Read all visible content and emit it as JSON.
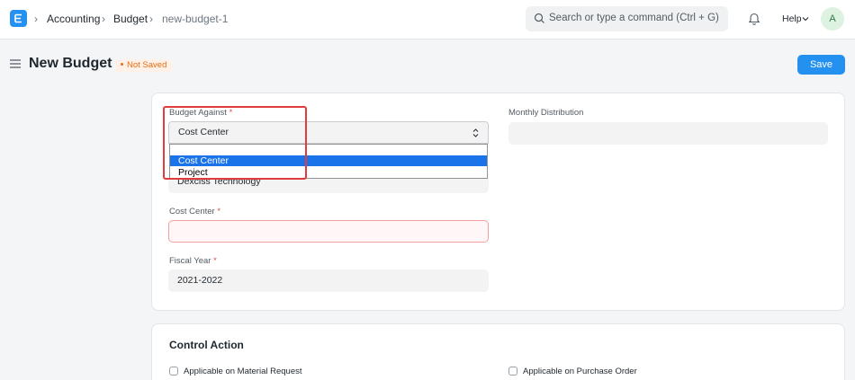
{
  "navbar": {
    "breadcrumbs": [
      "Accounting",
      "Budget",
      "new-budget-1"
    ],
    "search_placeholder": "Search or type a command (Ctrl + G)",
    "help_label": "Help",
    "avatar_initial": "A"
  },
  "page": {
    "title": "New Budget",
    "status_badge": "Not Saved",
    "save_label": "Save"
  },
  "form": {
    "budget_against": {
      "label": "Budget Against",
      "required_mark": "*",
      "value": "Cost Center",
      "options": [
        "Cost Center",
        "Project"
      ],
      "highlighted_option": "Cost Center"
    },
    "company": {
      "value": "Dexciss Technology"
    },
    "monthly_distribution": {
      "label": "Monthly Distribution",
      "value": ""
    },
    "cost_center": {
      "label": "Cost Center",
      "required_mark": "*",
      "value": ""
    },
    "fiscal_year": {
      "label": "Fiscal Year",
      "required_mark": "*",
      "value": "2021-2022"
    }
  },
  "control_action": {
    "title": "Control Action",
    "checkboxes": [
      {
        "label": "Applicable on Material Request",
        "checked": false
      },
      {
        "label": "Applicable on Purchase Order",
        "checked": false
      }
    ]
  },
  "colors": {
    "primary": "#2490ef",
    "highlight_box": "#e03c3c",
    "not_saved": "#e86c13",
    "required": "#e24c4c"
  }
}
